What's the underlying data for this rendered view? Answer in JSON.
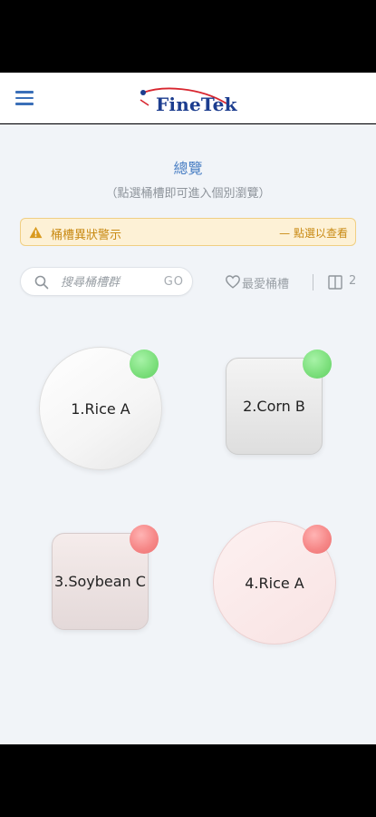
{
  "header": {
    "logo_text": "FineTek",
    "menu_icon": "hamburger-menu-icon"
  },
  "overview": {
    "title": "總覽",
    "subtitle": "（點選桶槽即可進入個別瀏覽）"
  },
  "alert": {
    "icon": "warning-icon",
    "text": "桶槽異狀警示",
    "link": "— 點選以查看",
    "color": "#c98a14",
    "background": "#fdf1d6"
  },
  "search": {
    "placeholder": "搜尋桶槽群",
    "value": "",
    "go_label": "GO"
  },
  "favorites": {
    "label": "最愛桶槽"
  },
  "layout": {
    "columns": "2"
  },
  "tanks": [
    {
      "label": "1.Rice A",
      "shape": "circle",
      "status": "green"
    },
    {
      "label": "2.Corn B",
      "shape": "rounded-square",
      "status": "green"
    },
    {
      "label": "3.Soybean C",
      "shape": "rounded-square",
      "status": "red"
    },
    {
      "label": "4.Rice A",
      "shape": "circle",
      "status": "red"
    }
  ],
  "colors": {
    "accent": "#4a7fc4",
    "status_green": "#7ee07e",
    "status_red": "#f68888",
    "background": "#f1f4f8"
  }
}
